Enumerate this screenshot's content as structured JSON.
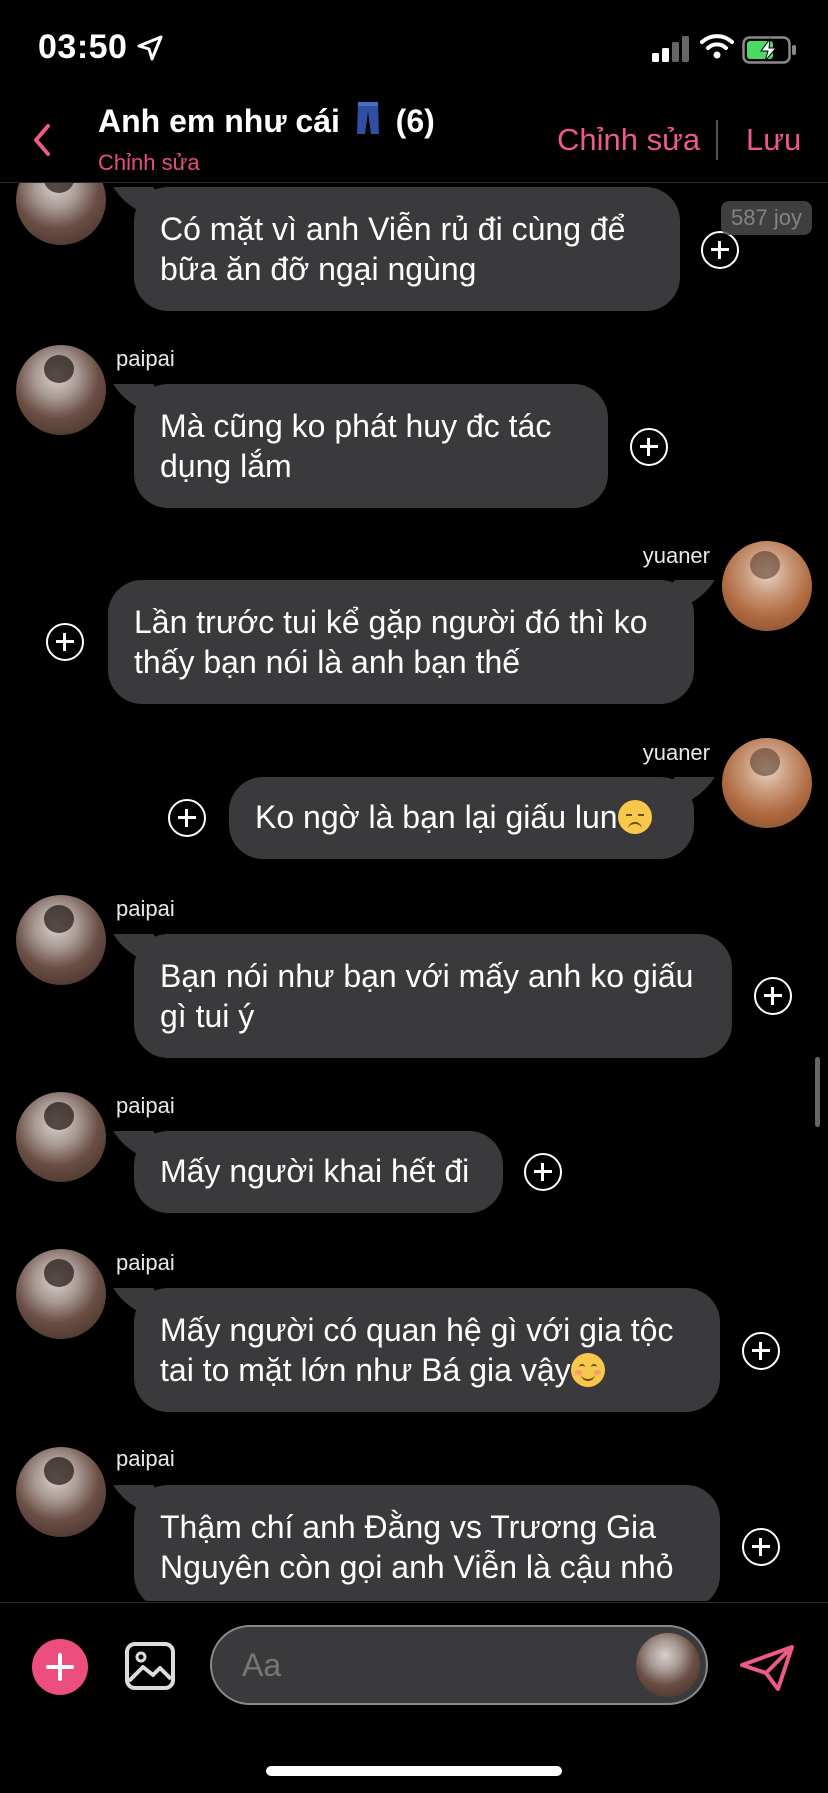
{
  "status": {
    "time": "03:50"
  },
  "header": {
    "title": "Anh em như cái",
    "member_count": "(6)",
    "subtitle": "Chỉnh sửa",
    "edit_label": "Chỉnh sửa",
    "save_label": "Lưu"
  },
  "badge": "587 joy",
  "messages": [
    {
      "sender": "",
      "side": "left",
      "text": "Có mặt vì anh Viễn rủ đi cùng để bữa ăn đỡ ngại ngùng",
      "emoji": ""
    },
    {
      "sender": "paipai",
      "side": "left",
      "text": "Mà cũng ko phát huy đc tác dụng lắm",
      "emoji": ""
    },
    {
      "sender": "yuaner",
      "side": "right",
      "text": "Lần trước tui kể gặp người đó thì ko thấy bạn nói là anh bạn thế",
      "emoji": ""
    },
    {
      "sender": "yuaner",
      "side": "right",
      "text": "Ko ngờ là bạn lại giấu lun",
      "emoji": "unamused-face"
    },
    {
      "sender": "paipai",
      "side": "left",
      "text": "Bạn nói như bạn với mấy anh ko giấu gì tui ý",
      "emoji": ""
    },
    {
      "sender": "paipai",
      "side": "left",
      "text": "Mấy người khai hết đi",
      "emoji": ""
    },
    {
      "sender": "paipai",
      "side": "left",
      "text": "Mấy người có quan hệ gì với gia tộc tai to mặt lớn như Bá gia vậy",
      "emoji": "smiling-face"
    },
    {
      "sender": "paipai",
      "side": "left",
      "text": "Thậm chí anh Đằng vs Trương Gia Nguyên còn gọi anh Viễn là cậu nhỏ",
      "emoji": ""
    }
  ],
  "composer": {
    "placeholder": "Aa"
  },
  "colors": {
    "accent": "#ec5a86",
    "bubble": "#3a3a3c",
    "background": "#000000"
  }
}
